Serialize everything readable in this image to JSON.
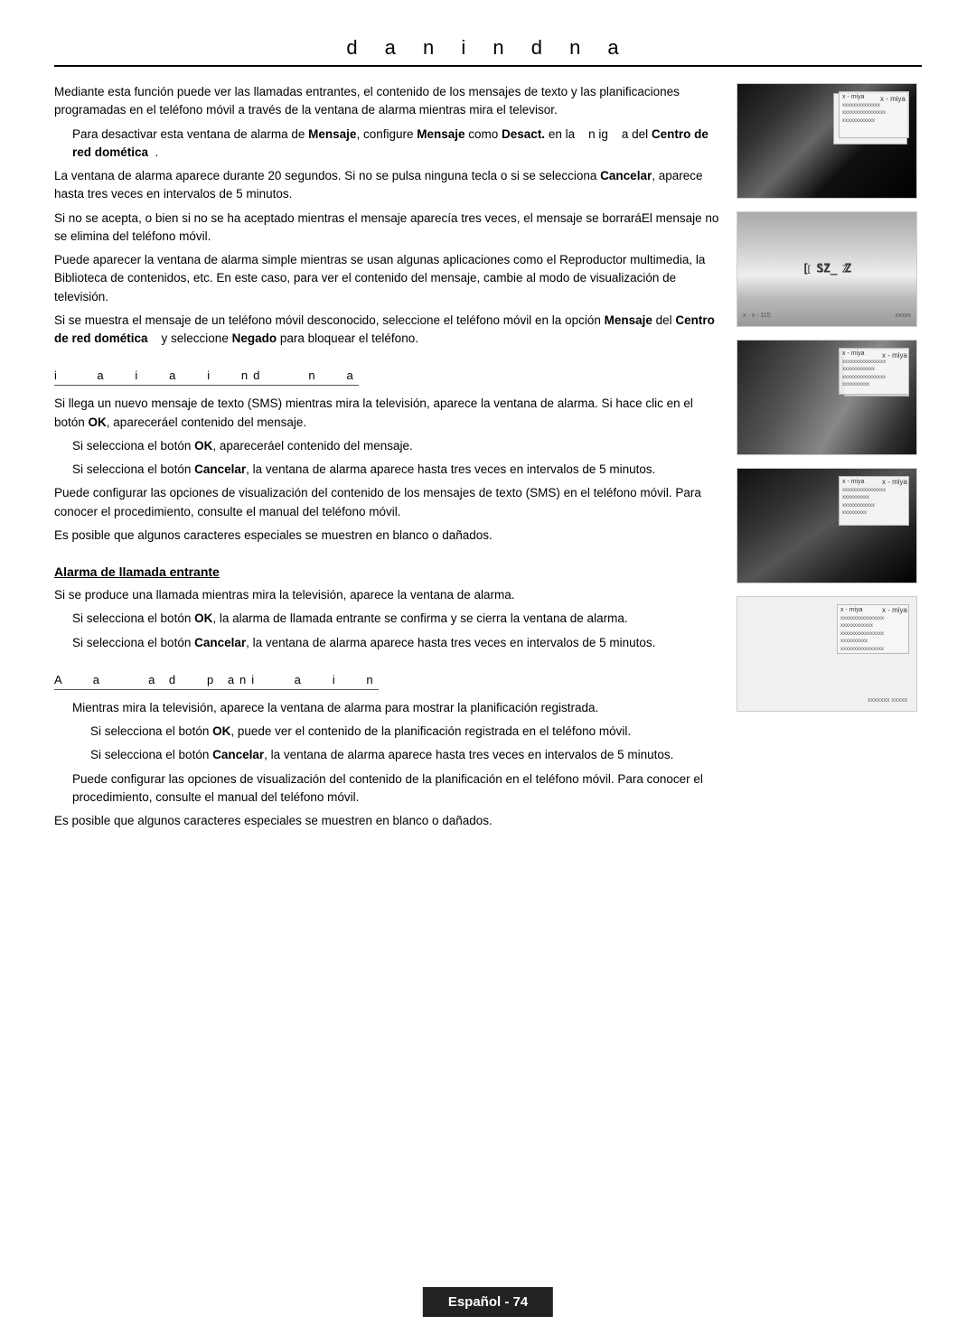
{
  "page": {
    "title": "d  a  n  i  n d  n a",
    "footer": "Español - 74",
    "sections": [
      {
        "id": "intro",
        "heading": null,
        "paragraphs": [
          "Mediante esta función puede ver las llamadas entrantes, el contenido de los mensajes de texto y las planificaciones programadas en el teléfono móvil a través de la ventana de alarma mientras mira el televisor.",
          "Para desactivar esta ventana de alarma de Mensaje, configure Mensaje como Desact. en la   n ig   a del Centro de red domética  .",
          "La ventana de alarma aparece durante 20 segundos. Si no se pulsa ninguna tecla o si se selecciona Cancelar, aparece hasta tres veces en intervalos de 5 minutos.",
          "Si no se acepta, o bien si no se ha aceptado mientras el mensaje aparecía tres veces, el mensaje se borraráEl mensaje no se elimina del teléfono móvil.",
          "Puede aparecer la ventana de alarma simple mientras se usan algunas aplicaciones como el Reproductor multimedia, la Biblioteca de contenidos, etc. En este caso, para ver el contenido del mensaje, cambie al modo de visualización de televisión.",
          "Si se muestra el mensaje de un teléfono móvil desconocido, seleccione el teléfono móvil en la opción Mensaje del Centro de red domética   y seleccione Negado para bloquear el teléfono."
        ]
      },
      {
        "id": "sms-alarm",
        "heading": "i   a  i  a  i  nd    n  a",
        "paragraphs": [
          "Si llega un nuevo mensaje de texto (SMS) mientras mira la televisión, aparece la ventana de alarma. Si hace clic en el botón OK, apareceráel contenido del mensaje.",
          "Si selecciona el botón OK, apareceráel contenido del mensaje.",
          "Si selecciona el botón Cancelar, la ventana de alarma aparece hasta tres veces en intervalos de 5 minutos.",
          "Puede configurar las opciones de visualización del contenido de los mensajes de texto (SMS) en el teléfono móvil. Para conocer el procedimiento, consulte el manual del teléfono móvil.",
          "Es posible que algunos caracteres especiales se muestren en blanco o dañados."
        ]
      },
      {
        "id": "incoming-call",
        "heading": "Alarma de llamada entrante",
        "paragraphs": [
          "Si se produce una llamada mientras mira la televisión, aparece la ventana de alarma.",
          "Si selecciona el botón OK, la alarma de llamada entrante se confirma y se cierra la ventana de alarma.",
          "Si selecciona el botón Cancelar, la ventana de alarma aparece hasta tres veces en intervalos de 5 minutos."
        ]
      },
      {
        "id": "schedule",
        "heading": "A  a   a d  p ani   a  i  n",
        "paragraphs": [
          "Mientras mira la televisión, aparece la ventana de alarma para mostrar la planificación registrada.",
          "Si selecciona el botón OK, puede ver el contenido de la planificación registrada en el teléfono móvil.",
          "Si selecciona el botón Cancelar, la ventana de alarma aparece hasta tres veces en intervalos de 5 minutos.",
          "Puede configurar las opciones de visualización del contenido de la planificación en el teléfono móvil. Para conocer el procedimiento, consulte el manual del teléfono móvil.",
          "Es posible que algunos caracteres especiales se muestren en blanco o dañados."
        ]
      }
    ]
  }
}
